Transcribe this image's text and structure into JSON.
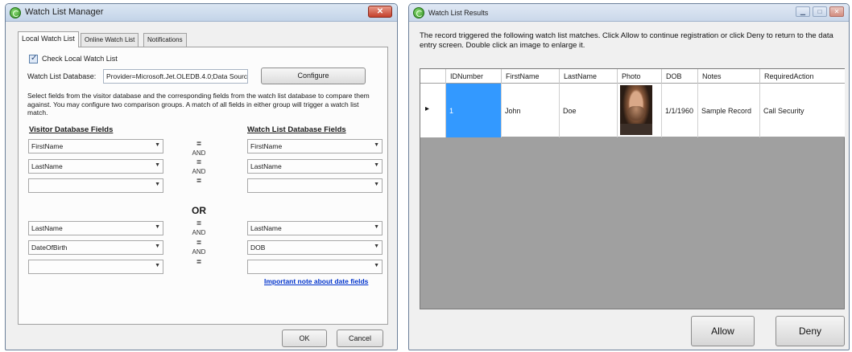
{
  "manager": {
    "title": "Watch List Manager",
    "tabs": [
      "Local Watch List",
      "Online Watch List",
      "Notifications"
    ],
    "check_label": "Check Local Watch List",
    "db_label": "Watch List Database:",
    "db_value": "Provider=Microsoft.Jet.OLEDB.4.0;Data Sourc",
    "configure_label": "Configure",
    "description": "Select fields from the visitor database and the corresponding fields from the watch list database to compare them against. You may configure two comparison groups. A match of all fields in either group will trigger a watch list match.",
    "visitor_header": "Visitor Database Fields",
    "watch_header": "Watch List Database Fields",
    "equals": "=",
    "and_label": "AND",
    "or_label": "OR",
    "group1": {
      "visitor": [
        "FirstName",
        "LastName",
        ""
      ],
      "watch": [
        "FirstName",
        "LastName",
        ""
      ]
    },
    "group2": {
      "visitor": [
        "LastName",
        "DateOfBirth",
        ""
      ],
      "watch": [
        "LastName",
        "DOB",
        ""
      ]
    },
    "note_link": "Important note about date fields",
    "ok_label": "OK",
    "cancel_label": "Cancel"
  },
  "results": {
    "title": "Watch List Results",
    "message": "The record triggered the following watch list matches. Click Allow to continue registration or click Deny to return to the data entry screen. Double click an image to enlarge it.",
    "columns": [
      "IDNumber",
      "FirstName",
      "LastName",
      "Photo",
      "DOB",
      "Notes",
      "RequiredAction"
    ],
    "rows": [
      {
        "id": "1",
        "first": "John",
        "last": "Doe",
        "dob": "1/1/1960",
        "notes": "Sample Record",
        "action": "Call Security"
      }
    ],
    "allow_label": "Allow",
    "deny_label": "Deny"
  },
  "icons": {
    "app_icon": "green-refresh-icon",
    "close": "close-icon",
    "minimize": "minimize-icon",
    "maximize": "maximize-icon",
    "dropdown": "chevron-down-icon",
    "row_indicator": "row-arrow-icon"
  }
}
